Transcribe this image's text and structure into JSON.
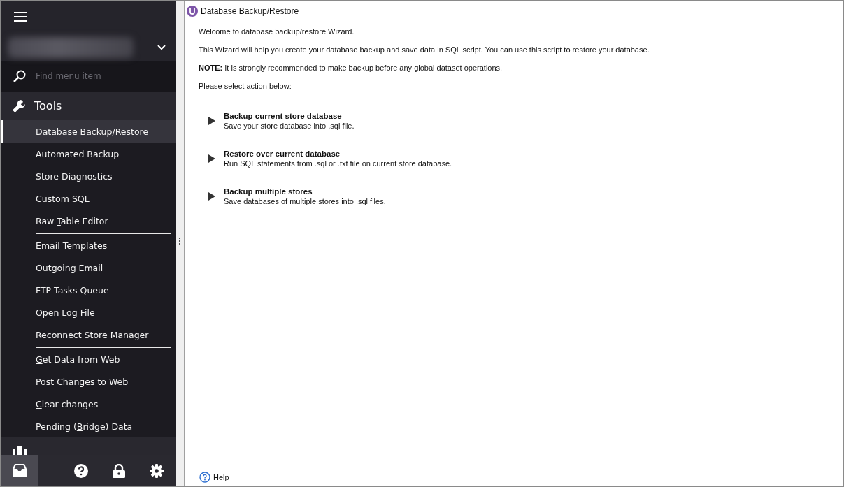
{
  "sidebar": {
    "search": {
      "placeholder": "Find menu item"
    },
    "section": {
      "label": "Tools",
      "expanded": true
    },
    "groups": [
      [
        {
          "pre": "Database Backup/",
          "key": "R",
          "post": "estore",
          "selected": true
        },
        {
          "label": "Automated Backup",
          "selected": false
        },
        {
          "label": "Store Diagnostics",
          "selected": false
        },
        {
          "pre": "Custom ",
          "key": "S",
          "post": "QL",
          "selected": false
        },
        {
          "pre": "Raw ",
          "key": "T",
          "post": "able Editor",
          "selected": false
        }
      ],
      [
        {
          "label": "Email Templates",
          "selected": false
        },
        {
          "label": "Outgoing Email",
          "selected": false
        },
        {
          "label": "FTP Tasks Queue",
          "selected": false
        },
        {
          "label": "Open Log File",
          "selected": false
        },
        {
          "label": "Reconnect Store Manager",
          "selected": false
        }
      ],
      [
        {
          "key": "G",
          "post": "et Data from Web",
          "selected": false
        },
        {
          "key": "P",
          "post": "ost Changes to Web",
          "selected": false
        },
        {
          "key": "C",
          "post": "lear changes",
          "selected": false
        },
        {
          "pre": "Pending (",
          "key": "B",
          "post": "ridge) Data",
          "selected": false
        }
      ]
    ],
    "bottom_buttons": [
      {
        "kind": "store",
        "selected": true
      },
      {
        "kind": "help",
        "selected": false
      },
      {
        "kind": "lock",
        "selected": false
      },
      {
        "kind": "settings",
        "selected": false
      }
    ]
  },
  "panel": {
    "title": "Database Backup/Restore",
    "intro": [
      "Welcome to database backup/restore Wizard.",
      "This Wizard will help you create your database backup and save data in SQL script. You can use this script to restore your database.",
      "**NOTE:** It is strongly recommended to make backup before any global dataset operations.",
      "Please select action below:"
    ],
    "actions": [
      {
        "title": "Backup current store database",
        "description": "Save your store database into .sql file."
      },
      {
        "title": "Restore over current database",
        "description": "Run SQL statements from .sql or .txt file on current store database."
      },
      {
        "title": "Backup multiple stores",
        "description": "Save databases of multiple stores into .sql files."
      }
    ],
    "help": {
      "key": "H",
      "post": "elp"
    }
  }
}
